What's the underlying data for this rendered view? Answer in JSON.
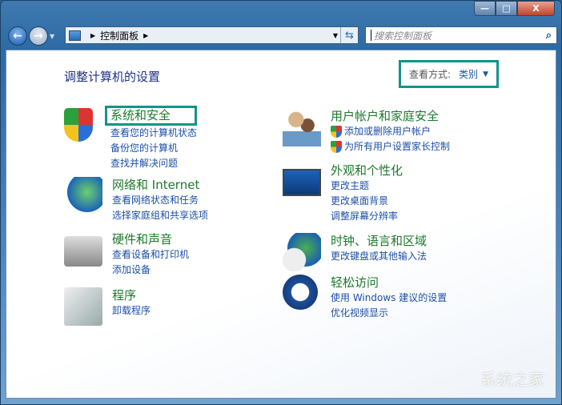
{
  "window": {
    "minimize": "—",
    "maximize": "□",
    "close": "X"
  },
  "address": {
    "crumb": "控制面板",
    "search_placeholder": "搜索控制面板"
  },
  "main": {
    "title": "调整计算机的设置",
    "view_by_label": "查看方式:",
    "view_by_value": "类别"
  },
  "categories": [
    {
      "title": "系统和安全",
      "links": [
        "查看您的计算机状态",
        "备份您的计算机",
        "查找并解决问题"
      ]
    },
    {
      "title": "网络和 Internet",
      "links": [
        "查看网络状态和任务",
        "选择家庭组和共享选项"
      ]
    },
    {
      "title": "硬件和声音",
      "links": [
        "查看设备和打印机",
        "添加设备"
      ]
    },
    {
      "title": "程序",
      "links": [
        "卸载程序"
      ]
    },
    {
      "title": "用户帐户和家庭安全",
      "links": [
        "添加或删除用户帐户",
        "为所有用户设置家长控制"
      ]
    },
    {
      "title": "外观和个性化",
      "links": [
        "更改主题",
        "更改桌面背景",
        "调整屏幕分辨率"
      ]
    },
    {
      "title": "时钟、语言和区域",
      "links": [
        "更改键盘或其他输入法"
      ]
    },
    {
      "title": "轻松访问",
      "links": [
        "使用 Windows 建议的设置",
        "优化视频显示"
      ]
    }
  ],
  "watermark": "系统之家"
}
